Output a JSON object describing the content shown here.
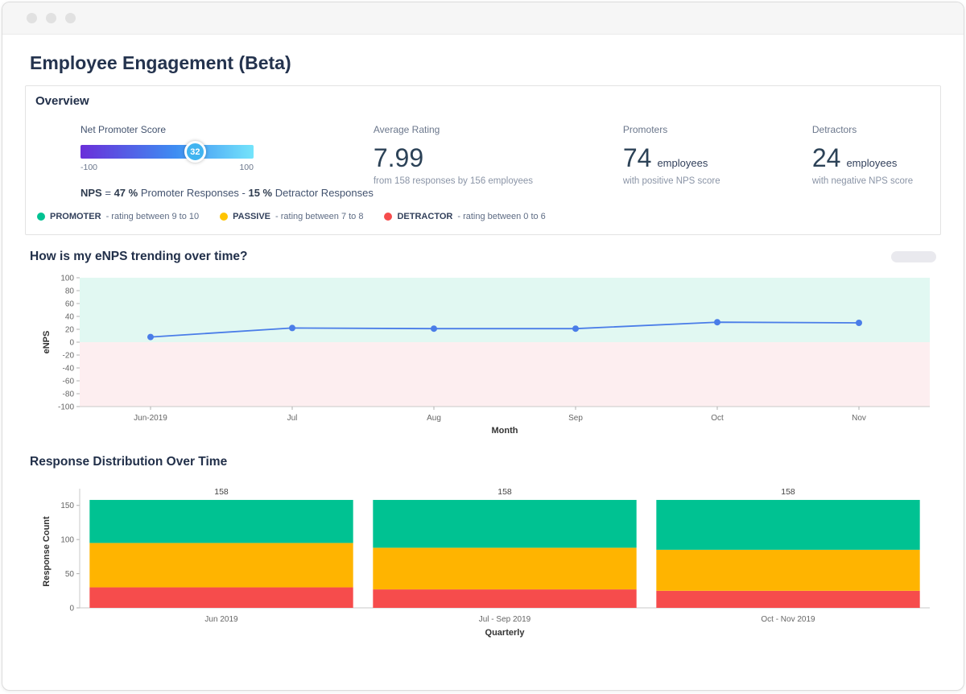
{
  "page": {
    "title": "Employee Engagement (Beta)"
  },
  "overview": {
    "title": "Overview",
    "nps": {
      "label": "Net Promoter Score",
      "score": "32",
      "scale_min": "-100",
      "scale_max": "100",
      "gradient": [
        "#6a2fd9",
        "#3e8df2",
        "#74e4fb"
      ],
      "formula_parts": [
        {
          "t": "NPS",
          "b": true
        },
        {
          "t": " = ",
          "b": false
        },
        {
          "t": "47 %",
          "b": true
        },
        {
          "t": " Promoter Responses - ",
          "b": false
        },
        {
          "t": "15 %",
          "b": true
        },
        {
          "t": " Detractor Responses",
          "b": false
        }
      ]
    },
    "legend": [
      {
        "name": "PROMOTER",
        "desc": "- rating between 9 to 10",
        "color": "#00c292"
      },
      {
        "name": "PASSIVE",
        "desc": "- rating between 7 to 8",
        "color": "#ffc400"
      },
      {
        "name": "DETRACTOR",
        "desc": "- rating between 0 to 6",
        "color": "#f64c4c"
      }
    ],
    "average_rating": {
      "label": "Average Rating",
      "value": "7.99",
      "sub": "from 158 responses by 156 employees"
    },
    "promoters": {
      "label": "Promoters",
      "value": "74",
      "unit": "employees",
      "sub": "with positive NPS score"
    },
    "detractors": {
      "label": "Detractors",
      "value": "24",
      "unit": "employees",
      "sub": "with negative NPS score"
    }
  },
  "sections": {
    "trend_title": "How is my eNPS trending over time?",
    "distribution_title": "Response Distribution Over Time"
  },
  "chart_data": [
    {
      "type": "line",
      "title": "How is my eNPS trending over time?",
      "x": [
        "Jun-2019",
        "Jul",
        "Aug",
        "Sep",
        "Oct",
        "Nov"
      ],
      "values": [
        8,
        22,
        21,
        21,
        31,
        30
      ],
      "xlabel": "Month",
      "ylabel": "eNPS",
      "ylim": [
        -100,
        100
      ],
      "yticks": [
        100,
        80,
        60,
        40,
        20,
        0,
        -20,
        -40,
        -60,
        -80,
        -100
      ],
      "line_color": "#4a7de8",
      "positive_band_color": "#e1f8f2",
      "negative_band_color": "#fdeef0",
      "grid": false,
      "legend_position": "none"
    },
    {
      "type": "bar",
      "stacked": true,
      "title": "Response Distribution Over Time",
      "categories": [
        "Jun 2019",
        "Jul - Sep 2019",
        "Oct - Nov 2019"
      ],
      "series": [
        {
          "name": "DETRACTOR",
          "color": "#f64c4c",
          "values": [
            30,
            27,
            25
          ]
        },
        {
          "name": "PASSIVE",
          "color": "#ffb400",
          "values": [
            65,
            61,
            60
          ]
        },
        {
          "name": "PROMOTER",
          "color": "#00c292",
          "values": [
            63,
            70,
            73
          ]
        }
      ],
      "totals": [
        158,
        158,
        158
      ],
      "xlabel": "Quarterly",
      "ylabel": "Response Count",
      "ylim": [
        0,
        165
      ],
      "yticks": [
        0,
        50,
        100,
        150
      ],
      "grid": false,
      "legend_position": "none"
    }
  ]
}
